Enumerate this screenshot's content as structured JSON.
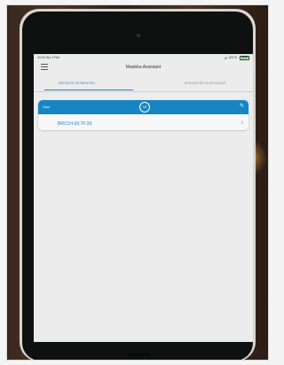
{
  "status_bar": {
    "time": "10:34",
    "date": "Wo 4 Feb",
    "battery": "100 %",
    "wifi_icon": "wifi-icon",
    "battery_icon": "battery-icon"
  },
  "app": {
    "title": "Madoka Assistant",
    "menu_icon": "hamburger-icon"
  },
  "tabs": [
    {
      "label": "RECENTE APPARATEN",
      "active": true
    },
    {
      "label": "APPARATEN IN DE BUURT",
      "active": false
    }
  ],
  "device_card": {
    "header_label": "Zaal",
    "status_icon_text": "18",
    "device_name": "BRC1H-93:7F:39",
    "accent_color": "#1785c4"
  }
}
